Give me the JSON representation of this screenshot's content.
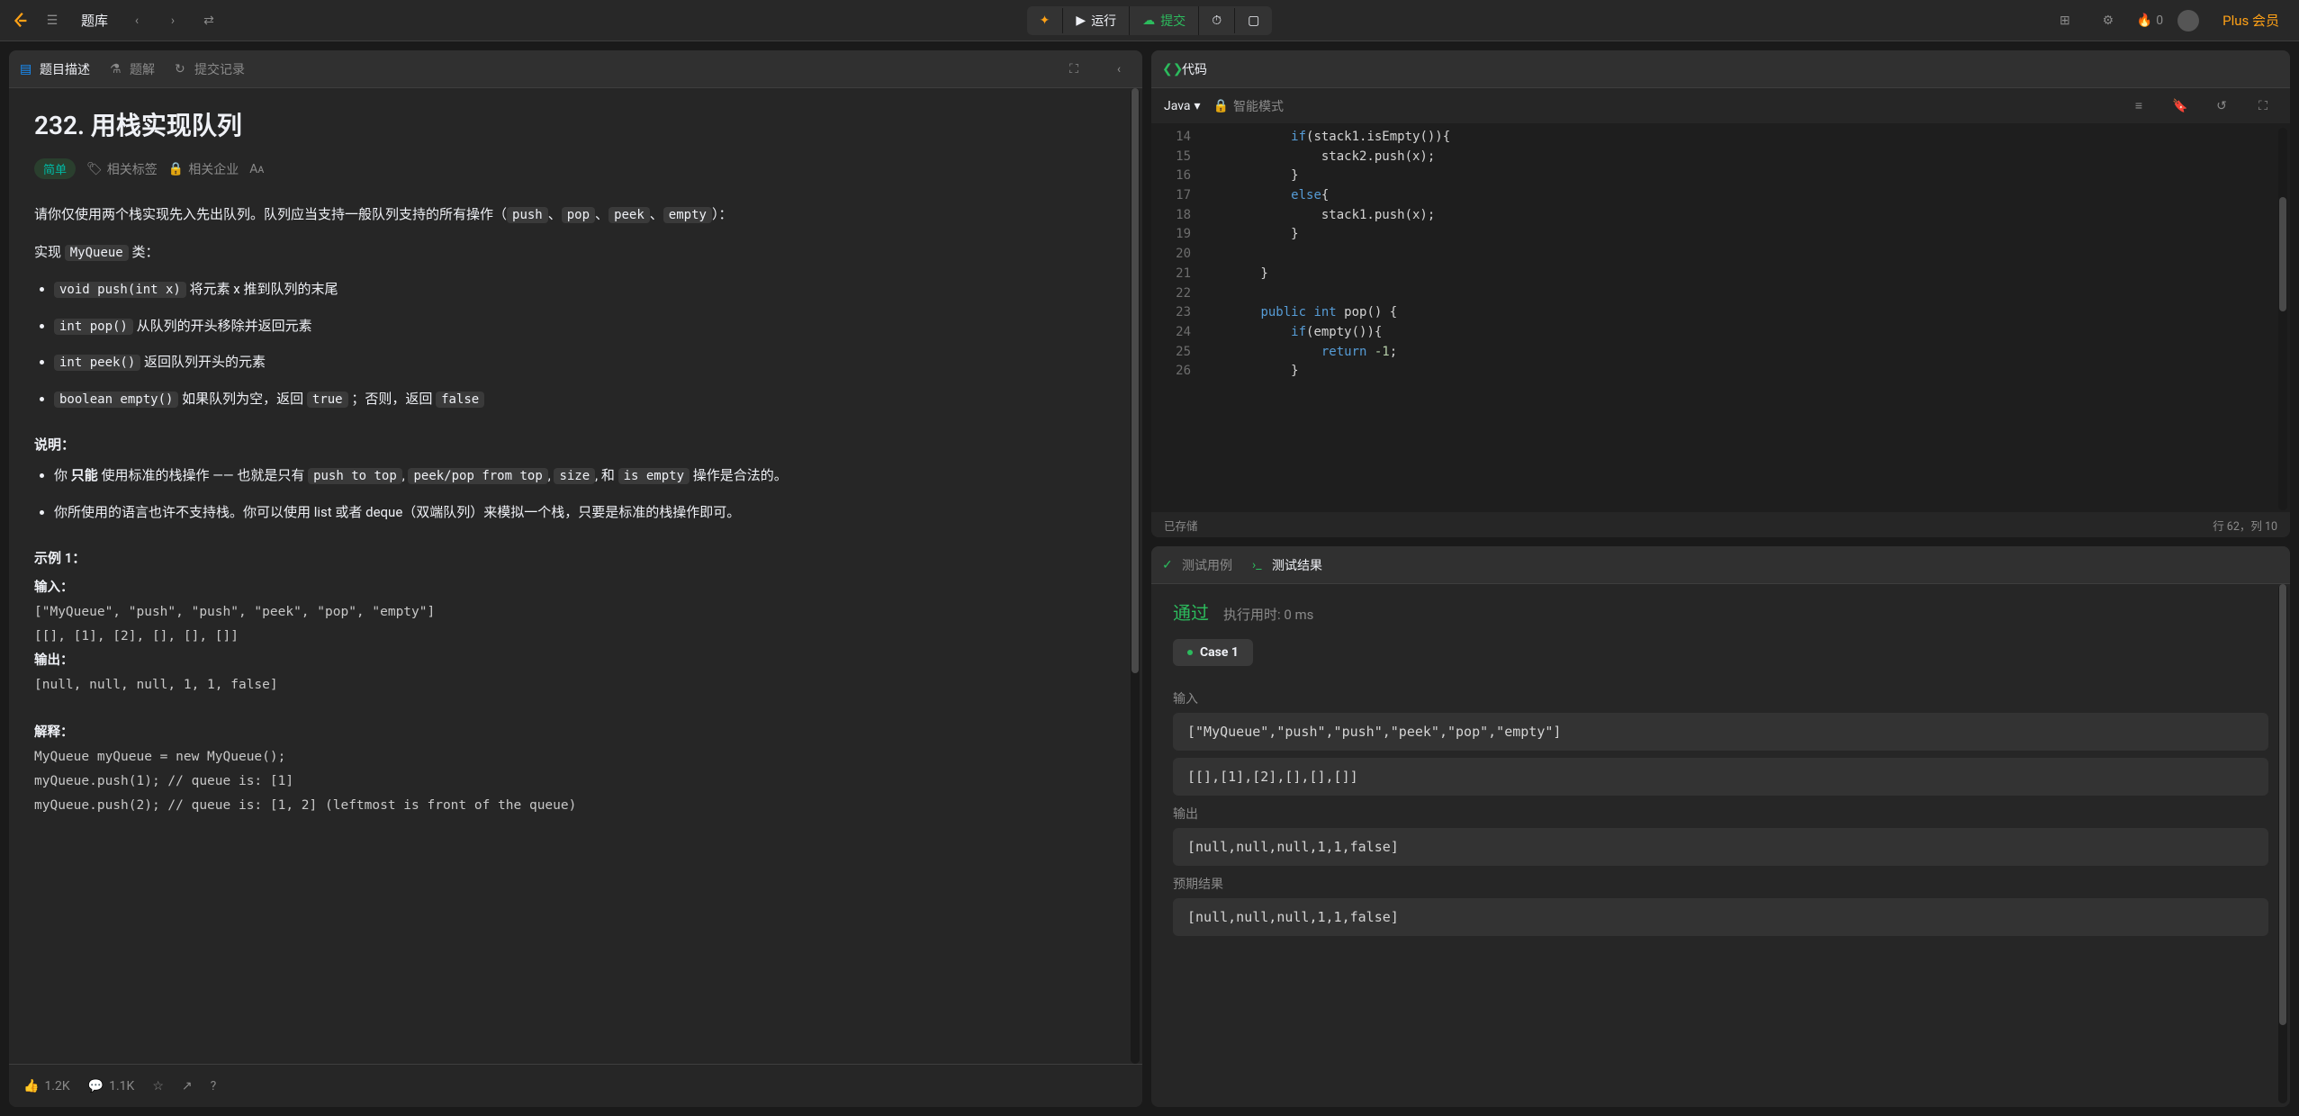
{
  "topbar": {
    "nav_label": "题库",
    "run_label": "运行",
    "submit_label": "提交",
    "streak_count": "0",
    "premium_label": "Plus 会员"
  },
  "left_tabs": {
    "description": "题目描述",
    "solution": "题解",
    "submissions": "提交记录"
  },
  "problem": {
    "title": "232. 用栈实现队列",
    "difficulty": "简单",
    "tags_label": "相关标签",
    "companies_label": "相关企业",
    "intro_p1a": "请你仅使用两个栈实现先入先出队列。队列应当支持一般队列支持的所有操作（",
    "codes": {
      "push": "push",
      "pop": "pop",
      "peek": "peek",
      "empty": "empty",
      "sep": "、",
      "close": "）："
    },
    "impl_line_a": "实现 ",
    "impl_code": "MyQueue",
    "impl_line_b": " 类：",
    "li1_code": "void push(int x)",
    "li1_text": " 将元素 x 推到队列的末尾",
    "li2_code": "int pop()",
    "li2_text": " 从队列的开头移除并返回元素",
    "li3_code": "int peek()",
    "li3_text": " 返回队列开头的元素",
    "li4_code": "boolean empty()",
    "li4_text_a": " 如果队列为空，返回 ",
    "li4_true": "true",
    "li4_text_b": " ；否则，返回 ",
    "li4_false": "false",
    "note_head": "说明：",
    "note_li1_a": "你 ",
    "note_li1_b": "只能",
    "note_li1_c": " 使用标准的栈操作 —— 也就是只有 ",
    "c_pt": "push to top",
    "sep2": ", ",
    "c_pp": "peek/pop from top",
    "c_sz": "size",
    "sep3": ", 和 ",
    "c_ie": "is empty",
    "note_li1_d": " 操作是合法的。",
    "note_li2": "你所使用的语言也许不支持栈。你可以使用 list 或者 deque（双端队列）来模拟一个栈，只要是标准的栈操作即可。",
    "ex_head": "示例 1：",
    "example": "输入：\n[\"MyQueue\", \"push\", \"push\", \"peek\", \"pop\", \"empty\"]\n[[], [1], [2], [], [], []]\n输出：\n[null, null, null, 1, 1, false]\n\n解释：\nMyQueue myQueue = new MyQueue();\nmyQueue.push(1); // queue is: [1]\nmyQueue.push(2); // queue is: [1, 2] (leftmost is front of the queue)"
  },
  "footer": {
    "likes": "1.2K",
    "comments": "1.1K"
  },
  "code_panel": {
    "title": "代码",
    "language": "Java",
    "mode": "智能模式",
    "status_saved": "已存储",
    "status_pos": "行 62，列 10",
    "line_start": 14,
    "lines": [
      {
        "i": "            ",
        "t": [
          [
            "kw",
            "if"
          ],
          [
            "",
            "(stack1.isEmpty()){"
          ]
        ]
      },
      {
        "i": "                ",
        "t": [
          [
            "",
            "stack2.push(x);"
          ]
        ]
      },
      {
        "i": "            ",
        "t": [
          [
            "",
            "}"
          ]
        ]
      },
      {
        "i": "            ",
        "t": [
          [
            "kw",
            "else"
          ],
          [
            "",
            "{"
          ]
        ]
      },
      {
        "i": "                ",
        "t": [
          [
            "",
            "stack1.push(x);"
          ]
        ]
      },
      {
        "i": "            ",
        "t": [
          [
            "",
            "}"
          ]
        ]
      },
      {
        "i": "",
        "t": [
          [
            "",
            ""
          ]
        ]
      },
      {
        "i": "        ",
        "t": [
          [
            "",
            "}"
          ]
        ]
      },
      {
        "i": "",
        "t": [
          [
            "",
            ""
          ]
        ]
      },
      {
        "i": "        ",
        "t": [
          [
            "kw",
            "public"
          ],
          [
            "",
            " "
          ],
          [
            "kw",
            "int"
          ],
          [
            "",
            " pop() {"
          ]
        ]
      },
      {
        "i": "            ",
        "t": [
          [
            "kw",
            "if"
          ],
          [
            "",
            "(empty()){"
          ]
        ]
      },
      {
        "i": "                ",
        "t": [
          [
            "kw",
            "return"
          ],
          [
            "",
            " "
          ],
          [
            "num",
            "-1"
          ],
          [
            "",
            ";"
          ]
        ]
      },
      {
        "i": "            ",
        "t": [
          [
            "",
            "}"
          ]
        ]
      }
    ]
  },
  "results": {
    "tab_cases": "测试用例",
    "tab_results": "测试结果",
    "status": "通过",
    "runtime": "执行用时: 0 ms",
    "case_label": "Case 1",
    "input_label": "输入",
    "input1": "[\"MyQueue\",\"push\",\"push\",\"peek\",\"pop\",\"empty\"]",
    "input2": "[[],[1],[2],[],[],[]]",
    "output_label": "输出",
    "output": "[null,null,null,1,1,false]",
    "expected_label": "预期结果",
    "expected": "[null,null,null,1,1,false]"
  }
}
